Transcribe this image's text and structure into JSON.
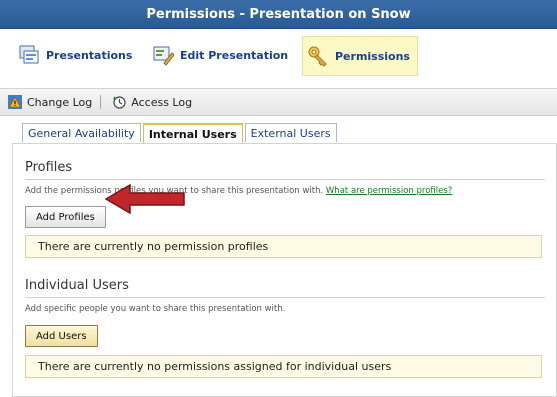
{
  "window": {
    "title": "Permissions - Presentation on Snow"
  },
  "nav": {
    "presentations": "Presentations",
    "edit_presentation": "Edit Presentation",
    "permissions": "Permissions"
  },
  "toolbar": {
    "change_log": "Change Log",
    "access_log": "Access Log"
  },
  "tabs": [
    "General Availability",
    "Internal Users",
    "External Users"
  ],
  "profiles": {
    "heading": "Profiles",
    "description": "Add the permissions profiles you want to share this presentation with.",
    "link": "What are permission profiles?",
    "button": "Add Profiles",
    "empty_message": "There are currently no permission profiles"
  },
  "individual_users": {
    "heading": "Individual Users",
    "description": "Add specific people you want to share this presentation with.",
    "button": "Add Users",
    "empty_message": "There are currently no permissions assigned for individual users"
  },
  "colors": {
    "accent": "#2a5a93",
    "notice_bg": "#fdfbe4",
    "arrow": "#c0262a"
  }
}
